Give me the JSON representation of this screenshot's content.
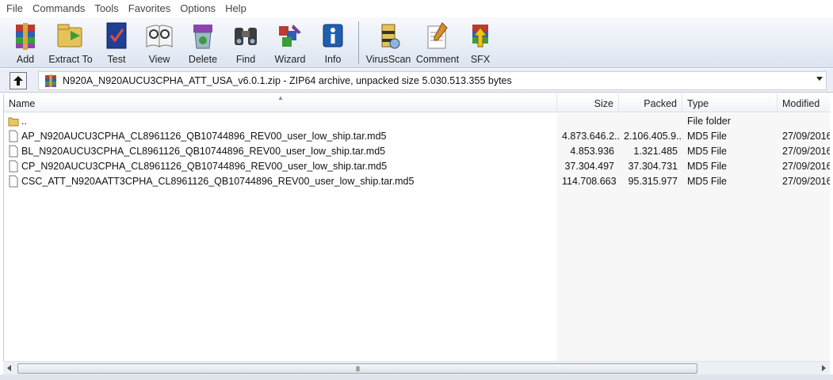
{
  "menu": [
    "File",
    "Commands",
    "Tools",
    "Favorites",
    "Options",
    "Help"
  ],
  "toolbar": [
    {
      "label": "Add",
      "icon": "add-icon"
    },
    {
      "label": "Extract To",
      "icon": "extract-icon"
    },
    {
      "label": "Test",
      "icon": "test-icon"
    },
    {
      "label": "View",
      "icon": "view-icon"
    },
    {
      "label": "Delete",
      "icon": "delete-icon"
    },
    {
      "label": "Find",
      "icon": "find-icon"
    },
    {
      "label": "Wizard",
      "icon": "wizard-icon"
    },
    {
      "label": "Info",
      "icon": "info-icon"
    },
    {
      "label": "VirusScan",
      "icon": "virusscan-icon"
    },
    {
      "label": "Comment",
      "icon": "comment-icon"
    },
    {
      "label": "SFX",
      "icon": "sfx-icon"
    }
  ],
  "address": {
    "path": "N920A_N920AUCU3CPHA_ATT_USA_v6.0.1.zip - ZIP64 archive, unpacked size 5.030.513.355 bytes"
  },
  "columns": {
    "name": "Name",
    "size": "Size",
    "packed": "Packed",
    "type": "Type",
    "modified": "Modified"
  },
  "rows": [
    {
      "name": "..",
      "size": "",
      "packed": "",
      "type": "File folder",
      "modified": "",
      "icon": "folder-icon"
    },
    {
      "name": "AP_N920AUCU3CPHA_CL8961126_QB10744896_REV00_user_low_ship.tar.md5",
      "size": "4.873.646.2...",
      "packed": "2.106.405.9...",
      "type": "MD5 File",
      "modified": "27/09/2016",
      "icon": "file-icon"
    },
    {
      "name": "BL_N920AUCU3CPHA_CL8961126_QB10744896_REV00_user_low_ship.tar.md5",
      "size": "4.853.936",
      "packed": "1.321.485",
      "type": "MD5 File",
      "modified": "27/09/2016",
      "icon": "file-icon"
    },
    {
      "name": "CP_N920AUCU3CPHA_CL8961126_QB10744896_REV00_user_low_ship.tar.md5",
      "size": "37.304.497",
      "packed": "37.304.731",
      "type": "MD5 File",
      "modified": "27/09/2016",
      "icon": "file-icon"
    },
    {
      "name": "CSC_ATT_N920AATT3CPHA_CL8961126_QB10744896_REV00_user_low_ship.tar.md5",
      "size": "114.708.663",
      "packed": "95.315.977",
      "type": "MD5 File",
      "modified": "27/09/2016",
      "icon": "file-icon"
    }
  ],
  "scrollbar": {
    "grip": "III"
  }
}
